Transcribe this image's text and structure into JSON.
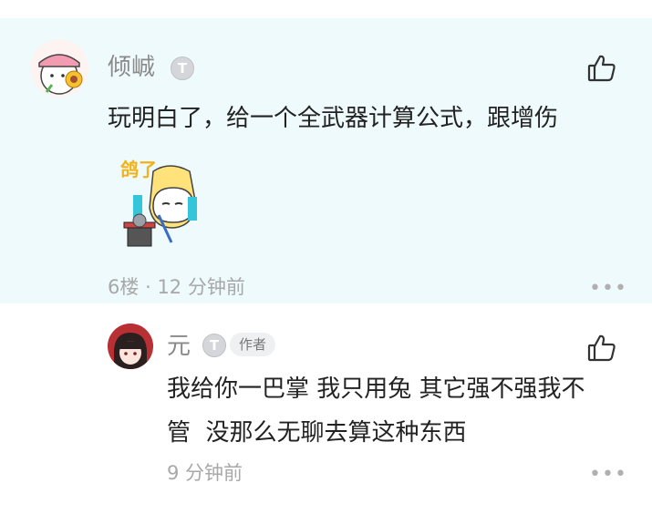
{
  "comment": {
    "username": "倾峸",
    "badge": "T",
    "text": "玩明白了，给一个全武器计算公式，跟增伤",
    "sticker_text": "鸽了",
    "floor": "6楼",
    "separator": "·",
    "time": "12 分钟前",
    "more": "•••"
  },
  "reply": {
    "username": "元",
    "badge": "T",
    "author_tag": "作者",
    "line1": "我给你一巴掌 我只用兔 其它强不强我不",
    "line2": "管  没那么无聊去算这种东西",
    "time": "9 分钟前",
    "more": "•••"
  },
  "colors": {
    "post_bg": "#eefafb",
    "username": "#8a8a8a",
    "meta": "#a8a8a8"
  }
}
